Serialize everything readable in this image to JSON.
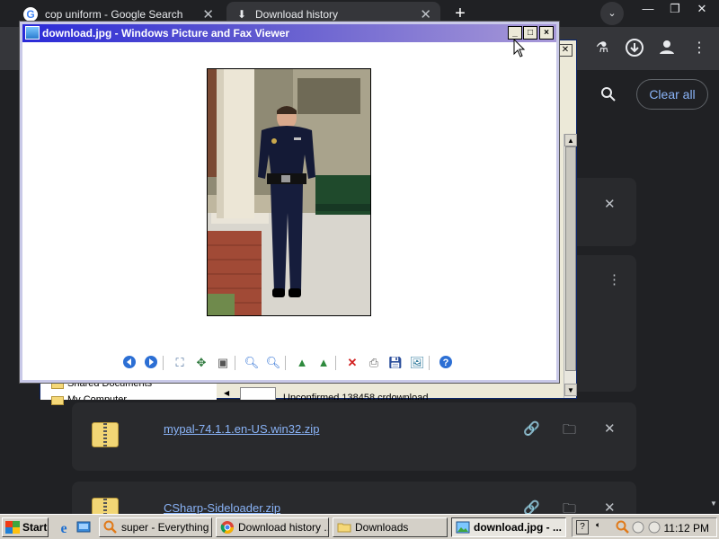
{
  "chrome": {
    "tabs": [
      {
        "title": "cop uniform - Google Search",
        "icon": "google-icon"
      },
      {
        "title": "Download history",
        "icon": "download-icon"
      }
    ],
    "new_tab": "+",
    "window_buttons": {
      "minimize": "—",
      "restore": "❐",
      "close": "✕"
    }
  },
  "downloads_page": {
    "clear_all": "Clear all",
    "items": [
      {
        "file": "mypal-74.1.1.en-US.win32.zip"
      },
      {
        "file": "CSharp-Sideloader.zip"
      }
    ]
  },
  "explorer": {
    "folders": [
      "Shared Documents",
      "My Computer"
    ],
    "file_text": "Unconfirmed 138458.crdownload"
  },
  "viewer": {
    "title": "download.jpg - Windows Picture and Fax Viewer",
    "buttons": {
      "minimize": "_",
      "maximize": "□",
      "close": "×"
    }
  },
  "taskbar": {
    "start": "Start",
    "tasks": [
      {
        "label": "super - Everything"
      },
      {
        "label": "Download history ..."
      },
      {
        "label": "Downloads"
      },
      {
        "label": "download.jpg - ..."
      }
    ],
    "clock": "11:12 PM"
  }
}
